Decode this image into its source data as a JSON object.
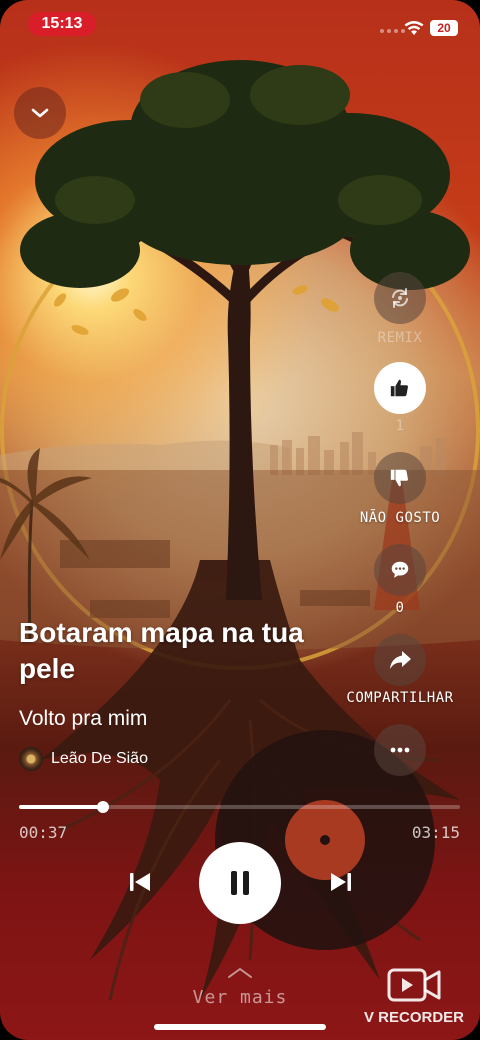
{
  "status_bar": {
    "time": "15:13",
    "battery": "20"
  },
  "song": {
    "title": "Botaram mapa na tua pele",
    "album": "Volto pra mim",
    "artist": "Leão De Sião"
  },
  "actions": {
    "remix_label": "REMIX",
    "like_count": "1",
    "dislike_label": "NÃO GOSTO",
    "comment_count": "0",
    "share_label": "COMPARTILHAR"
  },
  "player": {
    "elapsed": "00:37",
    "total": "03:15",
    "progress_fraction": 0.19,
    "state": "playing"
  },
  "footer": {
    "see_more": "Ver mais",
    "recorder_watermark": "V RECORDER"
  },
  "colors": {
    "accent_red": "#d91e2a",
    "background_top": "#b7301a",
    "background_bottom": "#8d1616"
  },
  "icons": [
    "chevron-down-icon",
    "remix-icon",
    "thumbs-up-icon",
    "thumbs-down-icon",
    "comment-icon",
    "share-arrow-icon",
    "more-icon",
    "skip-previous-icon",
    "pause-icon",
    "skip-next-icon",
    "chevron-up-icon",
    "video-recorder-icon",
    "wifi-icon"
  ]
}
